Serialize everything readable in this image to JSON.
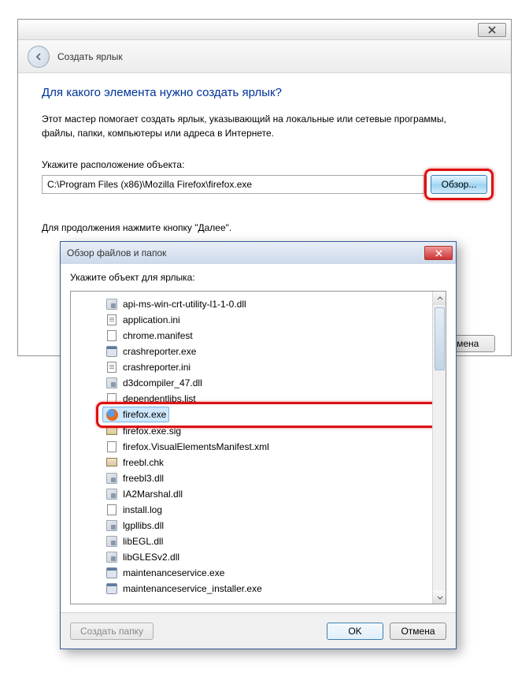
{
  "wizard": {
    "title": "Создать ярлык",
    "heading": "Для какого элемента нужно создать ярлык?",
    "desc1": "Этот мастер помогает создать ярлык, указывающий на локальные или сетевые программы,",
    "desc2": "файлы, папки, компьютеры или адреса в Интернете.",
    "location_label": "Укажите расположение объекта:",
    "path_value": "C:\\Program Files (x86)\\Mozilla Firefox\\firefox.exe",
    "browse_label": "Обзор...",
    "continue_hint": "Для продолжения нажмите кнопку \"Далее\".",
    "cancel_label": "тмена"
  },
  "browse": {
    "title": "Обзор файлов и папок",
    "instruction": "Укажите объект для ярлыка:",
    "mkdir_label": "Создать папку",
    "ok_label": "OK",
    "cancel_label": "Отмена",
    "files": [
      {
        "icon": "dll",
        "name": "api-ms-win-crt-utility-l1-1-0.dll"
      },
      {
        "icon": "ini",
        "name": "application.ini"
      },
      {
        "icon": "man",
        "name": "chrome.manifest"
      },
      {
        "icon": "exe",
        "name": "crashreporter.exe"
      },
      {
        "icon": "ini",
        "name": "crashreporter.ini"
      },
      {
        "icon": "dll",
        "name": "d3dcompiler_47.dll"
      },
      {
        "icon": "txt",
        "name": "dependentlibs.list"
      },
      {
        "icon": "firefox",
        "name": "firefox.exe",
        "selected": true
      },
      {
        "icon": "sig",
        "name": "firefox.exe.sig"
      },
      {
        "icon": "xml",
        "name": "firefox.VisualElementsManifest.xml"
      },
      {
        "icon": "sig",
        "name": "freebl.chk"
      },
      {
        "icon": "dll",
        "name": "freebl3.dll"
      },
      {
        "icon": "dll",
        "name": "IA2Marshal.dll"
      },
      {
        "icon": "txt",
        "name": "install.log"
      },
      {
        "icon": "dll",
        "name": "lgpllibs.dll"
      },
      {
        "icon": "dll",
        "name": "libEGL.dll"
      },
      {
        "icon": "dll",
        "name": "libGLESv2.dll"
      },
      {
        "icon": "exe",
        "name": "maintenanceservice.exe"
      },
      {
        "icon": "exe",
        "name": "maintenanceservice_installer.exe"
      }
    ]
  }
}
